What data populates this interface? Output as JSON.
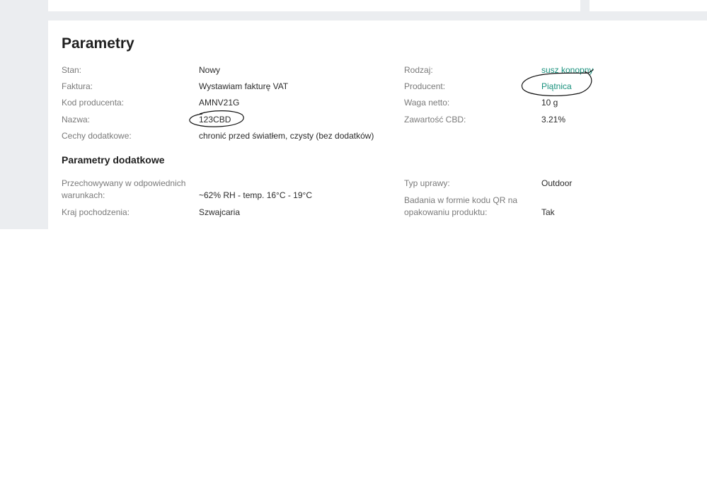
{
  "section": {
    "title": "Parametry",
    "subtitle": "Parametry dodatkowe"
  },
  "params_left": [
    {
      "label": "Stan:",
      "value": "Nowy"
    },
    {
      "label": "Faktura:",
      "value": "Wystawiam fakturę VAT"
    },
    {
      "label": "Kod producenta:",
      "value": "AMNV21G"
    },
    {
      "label": "Nazwa:",
      "value": "123CBD"
    },
    {
      "label": "Cechy dodatkowe:",
      "value": "chronić przed światłem, czysty (bez dodatków)"
    }
  ],
  "params_right": [
    {
      "label": "Rodzaj:",
      "value": "susz konopny"
    },
    {
      "label": "Producent:",
      "value": "Piątnica"
    },
    {
      "label": "Waga netto:",
      "value": "10 g"
    },
    {
      "label": "Zawartość CBD:",
      "value": "3.21%"
    }
  ],
  "extra_left": [
    {
      "label_line1": "Przechowywany w odpowiednich",
      "label_line2": "warunkach:",
      "value": "~62% RH - temp. 16°C - 19°C"
    },
    {
      "label": "Kraj pochodzenia:",
      "value": "Szwajcaria"
    }
  ],
  "extra_right": [
    {
      "label": "Typ uprawy:",
      "value": "Outdoor"
    },
    {
      "label_line1": "Badania w formie kodu QR na",
      "label_line2": "opakowaniu produktu:",
      "value": "Tak"
    }
  ],
  "colors": {
    "link": "#17907c",
    "page_background": "#ebedf0",
    "annotation": "#111111"
  }
}
